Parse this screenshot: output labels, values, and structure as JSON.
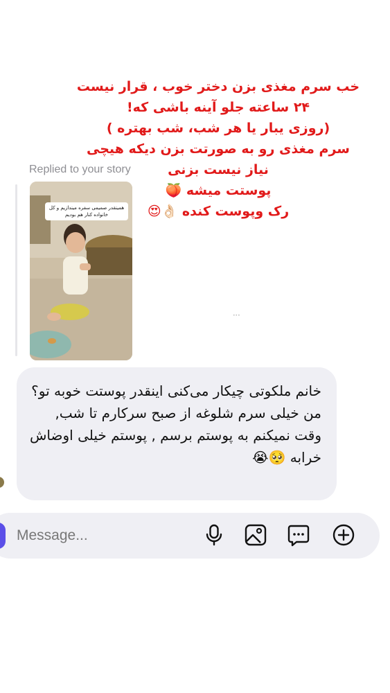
{
  "overlay_text": {
    "lines": [
      "خب سرم مغذی بزن دختر خوب ، قرار نیست",
      "۲۴ ساعته جلو آینه باشی که!",
      "(روزی یبار یا هر شب، شب بهتره )",
      "سرم مغذی رو به صورتت بزن دیکه هیچی",
      "نیاز نیست بزنی",
      "پوستت میشه 🍑",
      "رک وپوست کنده 👌🏻😍"
    ]
  },
  "reply": {
    "label": "Replied to your story",
    "story_caption": "همینقدر صمیمی سفره میندازیم و کل خانواده کنار هم بودیم"
  },
  "message": {
    "paragraph1": "خانم ملکوتی چیکار می‌کنی اینقدر پوستت خوبه تو؟",
    "paragraph2": "من خیلی سرم شلوغه از صبح سرکارم تا شب, وقت نمیکنم به پوستم برسم , پوستم خیلی اوضاش خرابه 🥺😭"
  },
  "composer": {
    "placeholder": "Message...",
    "icons": [
      "microphone-icon",
      "image-icon",
      "sticker-chat-icon",
      "add-icon"
    ]
  }
}
